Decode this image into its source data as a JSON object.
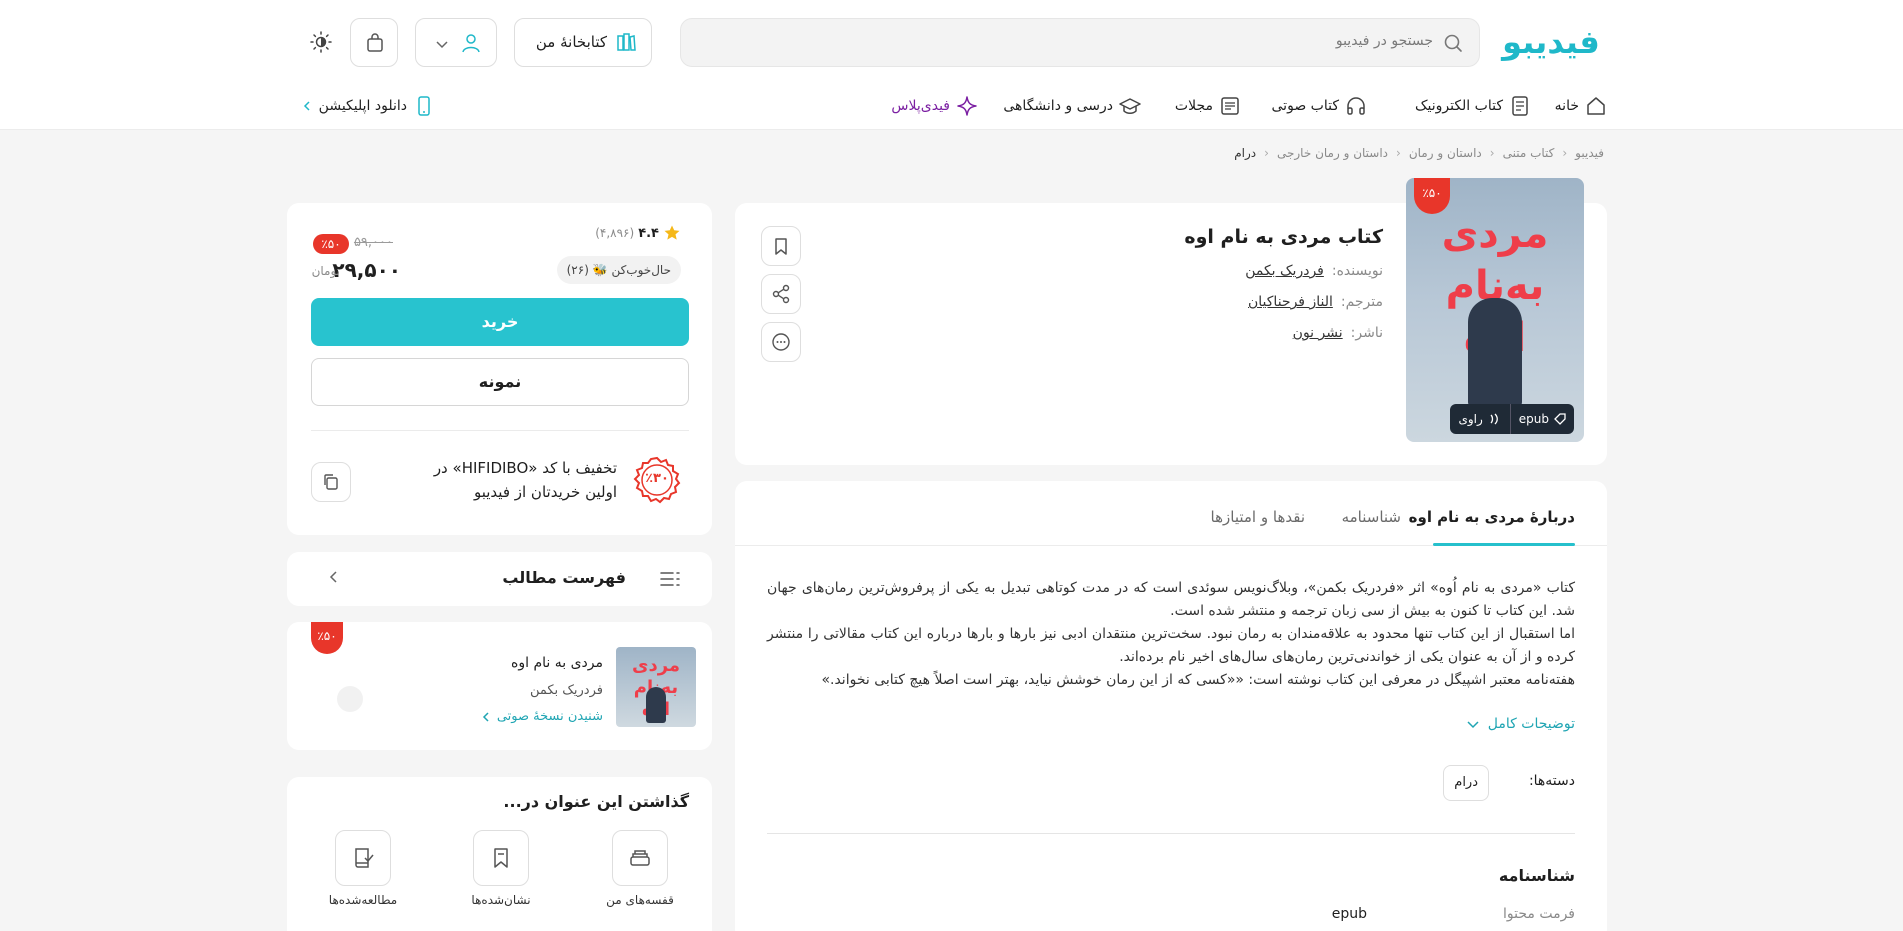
{
  "header": {
    "logo": "فیدیبو",
    "search_placeholder": "جستجو در فیدیبو",
    "library_label": "کتابخانهٔ من"
  },
  "nav": {
    "home": "خانه",
    "ebook": "کتاب الکترونیک",
    "audiobook": "کتاب صوتی",
    "magazines": "مجلات",
    "academic": "درسی و دانشگاهی",
    "plus": "فیدی‌پلاس",
    "download_app": "دانلود اپلیکیشن"
  },
  "breadcrumb": [
    "فیدیبو",
    "کتاب متنی",
    "داستان و رمان",
    "داستان و رمان خارجی",
    "درام"
  ],
  "book": {
    "title": "کتاب مردی به نام اوه",
    "author_key": "نویسنده:",
    "author": "فردریک بکمن",
    "translator_key": "مترجم:",
    "translator": "الناز فرحناکیان",
    "publisher_key": "ناشر:",
    "publisher": "نشر نون",
    "cover_title": "مردی به‌نام اوه",
    "cover_subtitle": "فردریک بکمن",
    "discount_badge": "٪۵۰",
    "tag_epub": "epub",
    "tag_narrator": "راوی"
  },
  "tabs": [
    "دربارهٔ مردی به نام اوه",
    "شناسنامه",
    "نقدها و امتیازها"
  ],
  "description": {
    "p1": "کتاب «مردی به نام اُوه» اثر «فردریک بکمن»، وبلاگ‌نویس سوئدی است که در مدت کوتاهی تبدیل به یکی از پرفروش‌ترین رمان‌های جهان شد. این کتاب تا کنون به بیش از سی زبان ترجمه و منتشر شده است.",
    "p2": "اما استقبال از این کتاب تنها محدود به علاقه‌مندان به رمان نبود. سخت‌ترین منتقدان ادبی نیز بارها و بارها درباره این کتاب مقالاتی را منتشر کرده و از آن به عنوان یکی از خواندنی‌ترین رمان‌های سال‌های اخیر نام برده‌اند.",
    "p3": "هفته‌نامه معتبر اشپیگل در معرفی این کتاب نوشته است: ««کسی که از این رمان خوشش نیاید، بهتر است اصلاً هیچ کتابی نخواند.»",
    "more": "توضیحات کامل"
  },
  "categories": {
    "label": "دسته‌ها:",
    "items": [
      "درام"
    ]
  },
  "identity": {
    "title": "شناسنامه",
    "format_key": "فرمت محتوا",
    "format_value": "epub"
  },
  "purchase": {
    "rating": "۴.۴",
    "rating_count": "(۴,۸۹۶)",
    "mood": "حال‌خوب‌کن 🐝 (۲۶)",
    "old_price": "۵۹,۰۰۰",
    "discount": "٪۵۰",
    "price": "۲۹,۵۰۰",
    "currency": "تومان",
    "buy": "خرید",
    "sample": "نمونه",
    "promo_badge": "٪۳۰",
    "promo_text": "تخفیف با کد «HIFIDIBO» در اولین خریدتان از فیدیبو"
  },
  "toc": {
    "title": "فهرست مطالب"
  },
  "audio": {
    "badge": "٪۵۰",
    "title": "مردی به نام اوه",
    "author": "فردریک بکمن",
    "link": "شنیدن نسخهٔ صوتی",
    "cover_title": "مردی به‌نام اوه"
  },
  "shelf": {
    "title": "گذاشتن این عنوان در...",
    "shelves": "قفسه‌های من",
    "bookmarked": "نشان‌شده‌ها",
    "read": "مطالعه‌شده‌ها"
  },
  "colors": {
    "accent": "#28c3cf",
    "discount": "#e8362a",
    "plus": "#7b1fa2"
  }
}
